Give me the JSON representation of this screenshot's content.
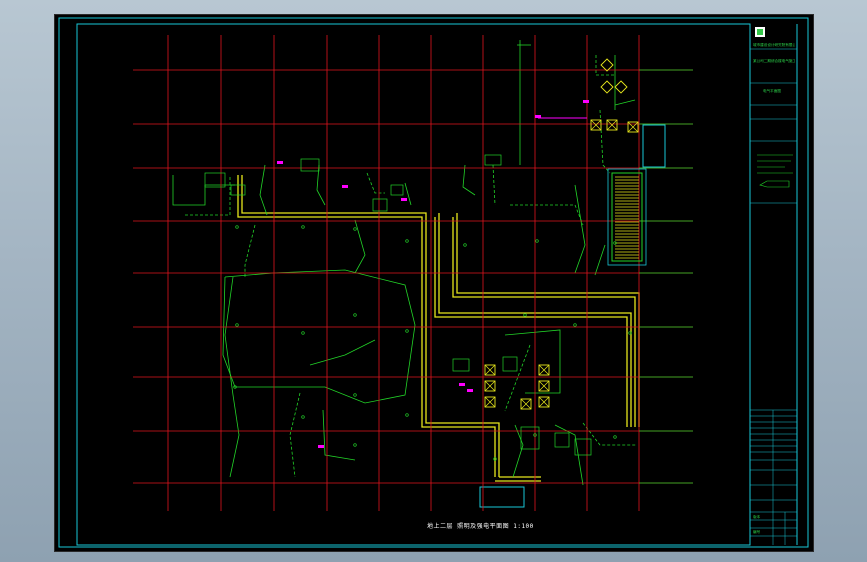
{
  "drawing": {
    "title": "地上二层 照明及强电平面图 1:100",
    "title_block": {
      "company": "城市建设设计研究院有限公司",
      "project": "某公司二期综合楼电气施工图",
      "drawing_name": "电气平面图",
      "revision": "版本",
      "sheet_no": "编号"
    }
  },
  "colors": {
    "background": "#000000",
    "grid": "#e0141e",
    "border": "#18c8d8",
    "walls": "#e6e61c",
    "green_lines": "#22d428",
    "magenta": "#ff00ff",
    "cyan_fixture": "#18c8d8"
  }
}
